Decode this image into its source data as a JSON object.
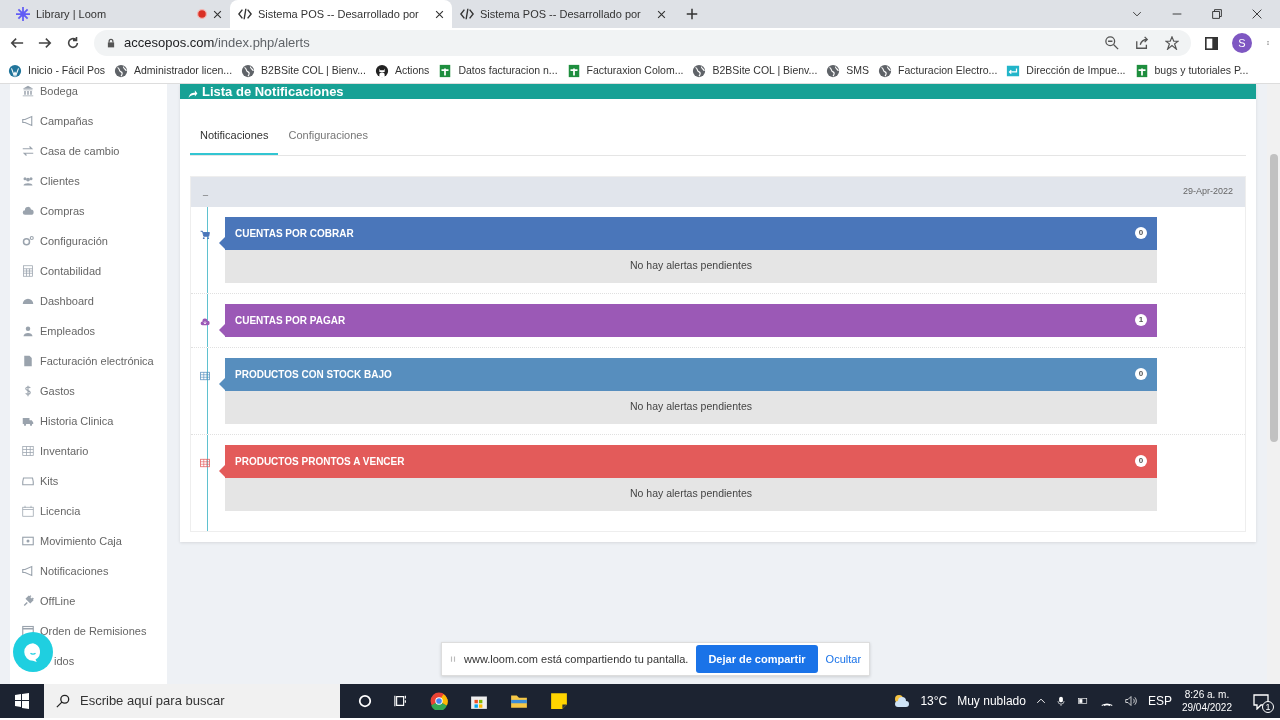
{
  "browser": {
    "tabs": [
      {
        "title": "Library | Loom",
        "kind": "loom",
        "recording": true,
        "selected": false
      },
      {
        "title": "Sistema POS -- Desarrollado por",
        "kind": "code",
        "recording": false,
        "selected": true
      },
      {
        "title": "Sistema POS -- Desarrollado por",
        "kind": "code",
        "recording": false,
        "selected": false
      }
    ],
    "url_host": "accesopos.com",
    "url_path": "/index.php/alerts",
    "profile": "S",
    "bookmarks": [
      {
        "label": "Inicio - Fácil Pos",
        "kind": "wp"
      },
      {
        "label": "Administrador licen...",
        "kind": "globe"
      },
      {
        "label": "B2BSite COL | Bienv...",
        "kind": "globe"
      },
      {
        "label": "Actions",
        "kind": "github"
      },
      {
        "label": "Datos facturacion n...",
        "kind": "sheet"
      },
      {
        "label": "Facturaxion Colom...",
        "kind": "sheet"
      },
      {
        "label": "B2BSite COL | Bienv...",
        "kind": "globe"
      },
      {
        "label": "SMS",
        "kind": "globe"
      },
      {
        "label": "Facturacion Electro...",
        "kind": "globe"
      },
      {
        "label": "Dirección de Impue...",
        "kind": "dian"
      },
      {
        "label": "bugs y tutoriales P...",
        "kind": "sheet"
      }
    ]
  },
  "sidebar": {
    "items": [
      {
        "label": "Bodega",
        "kind": "bank"
      },
      {
        "label": "Campañas",
        "kind": "megaphone"
      },
      {
        "label": "Casa de cambio",
        "kind": "arrows"
      },
      {
        "label": "Clientes",
        "kind": "people"
      },
      {
        "label": "Compras",
        "kind": "cloud"
      },
      {
        "label": "Configuración",
        "kind": "gears"
      },
      {
        "label": "Contabilidad",
        "kind": "calculator"
      },
      {
        "label": "Dashboard",
        "kind": "gauge"
      },
      {
        "label": "Empleados",
        "kind": "person"
      },
      {
        "label": "Facturación electrónica",
        "kind": "document"
      },
      {
        "label": "Gastos",
        "kind": "dollar"
      },
      {
        "label": "Historia Clinica",
        "kind": "ambulance"
      },
      {
        "label": "Inventario",
        "kind": "table"
      },
      {
        "label": "Kits",
        "kind": "tray"
      },
      {
        "label": "Licencia",
        "kind": "calendar"
      },
      {
        "label": "Movimiento Caja",
        "kind": "cash"
      },
      {
        "label": "Notificaciones",
        "kind": "megaphone"
      },
      {
        "label": "OffLine",
        "kind": "plug"
      },
      {
        "label": "Orden de Remisiones",
        "kind": "window"
      },
      {
        "label": "idos",
        "kind": "hidden"
      }
    ]
  },
  "panel": {
    "title": "Lista de Notificaciones",
    "tabs": [
      {
        "label": "Notificaciones",
        "selected": true
      },
      {
        "label": "Configuraciones",
        "selected": false
      }
    ],
    "date_bar": {
      "left": "_",
      "date": "29-Apr-2022"
    },
    "alerts": [
      {
        "title": "CUENTAS POR COBRAR",
        "count": "0",
        "color": "#4a76ba",
        "kind": "cart",
        "message": "No hay alertas pendientes"
      },
      {
        "title": "CUENTAS POR PAGAR",
        "count": "1",
        "color": "#9b59b6",
        "kind": "cloud"
      },
      {
        "title": "PRODUCTOS CON STOCK BAJO",
        "count": "0",
        "color": "#578ebe",
        "kind": "table",
        "message": "No hay alertas pendientes"
      },
      {
        "title": "PRODUCTOS PRONTOS A VENCER",
        "count": "0",
        "color": "#e35b5a",
        "kind": "table",
        "message": "No hay alertas pendientes"
      }
    ]
  },
  "share_bar": {
    "message": "www.loom.com está compartiendo tu pantalla.",
    "stop": "Dejar de compartir",
    "hide": "Ocultar"
  },
  "taskbar": {
    "search_placeholder": "Escribe aquí para buscar",
    "temperature": "13°C",
    "weather": "Muy nublado",
    "language": "ESP",
    "time": "8:26 a. m.",
    "date": "29/04/2022",
    "notifications": "1"
  }
}
